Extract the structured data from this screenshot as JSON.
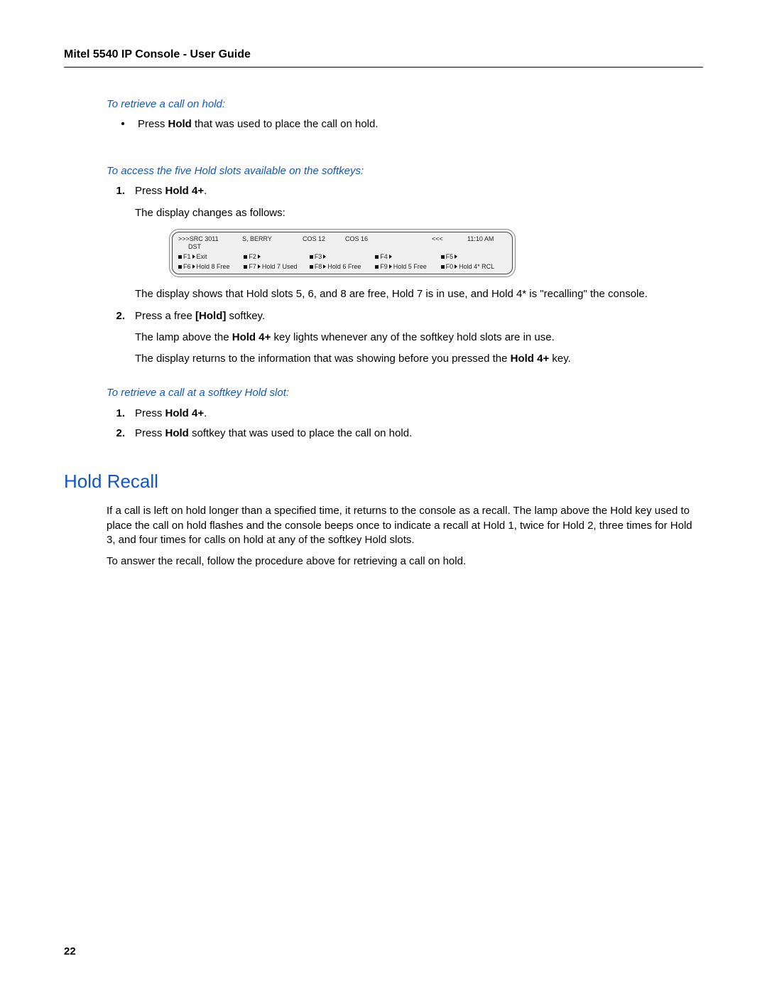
{
  "header": {
    "title": "Mitel 5540 IP Console - User Guide"
  },
  "section1": {
    "heading": "To retrieve a call on hold:",
    "bullet_prefix": "Press ",
    "bullet_bold": "Hold",
    "bullet_suffix": " that was used to place the call on hold."
  },
  "section2": {
    "heading": "To access the five Hold slots available on the softkeys:",
    "step1_prefix": "Press ",
    "step1_bold": "Hold 4+",
    "step1_suffix": ".",
    "after_step1": "The display changes as follows:",
    "lcd": {
      "src": ">>>SRC  3011",
      "name": "S, BERRY",
      "cos12": "COS 12",
      "cos16": "COS 16",
      "arrows": "<<<",
      "time": "11:10 AM",
      "dst": "DST",
      "row_top": [
        {
          "f": "F1",
          "label": "Exit"
        },
        {
          "f": "F2",
          "label": ""
        },
        {
          "f": "F3",
          "label": ""
        },
        {
          "f": "F4",
          "label": ""
        },
        {
          "f": "F5",
          "label": ""
        }
      ],
      "row_bottom": [
        {
          "f": "F6",
          "label": "Hold 8 Free"
        },
        {
          "f": "F7",
          "label": "Hold 7 Used"
        },
        {
          "f": "F8",
          "label": "Hold 6 Free"
        },
        {
          "f": "F9",
          "label": "Hold 5 Free"
        },
        {
          "f": "F0",
          "label": "Hold 4* RCL"
        }
      ]
    },
    "explain1": "The display shows that Hold slots 5, 6, and 8 are free, Hold 7 is in use, and Hold 4* is \"recalling\" the console.",
    "step2_prefix": "Press a free ",
    "step2_bold": "[Hold]",
    "step2_suffix": " softkey.",
    "explain2_a": "The lamp above the ",
    "explain2_b": "Hold 4+",
    "explain2_c": " key lights whenever any of the softkey hold slots are in use.",
    "explain3_a": "The display returns to the information that was showing before you pressed the ",
    "explain3_b": "Hold 4+",
    "explain3_c": " key."
  },
  "section3": {
    "heading": "To retrieve a call at a softkey Hold slot:",
    "step1_prefix": "Press ",
    "step1_bold": "Hold 4+",
    "step1_suffix": ".",
    "step2_prefix": "Press ",
    "step2_bold": "Hold",
    "step2_suffix": " softkey that was used to place the call on hold."
  },
  "hold_recall": {
    "title": "Hold Recall",
    "para1": "If a call is left on hold longer than a specified time, it returns to the console as a recall. The lamp above the Hold key used to place the call on hold flashes and the console beeps once to indicate a recall at Hold 1, twice for Hold 2, three times for Hold 3, and four times for calls on hold at any of the softkey Hold slots.",
    "para2": "To answer the recall, follow the procedure above for retrieving a call on hold."
  },
  "page_number": "22",
  "list_numbers": {
    "one": "1.",
    "two": "2."
  }
}
